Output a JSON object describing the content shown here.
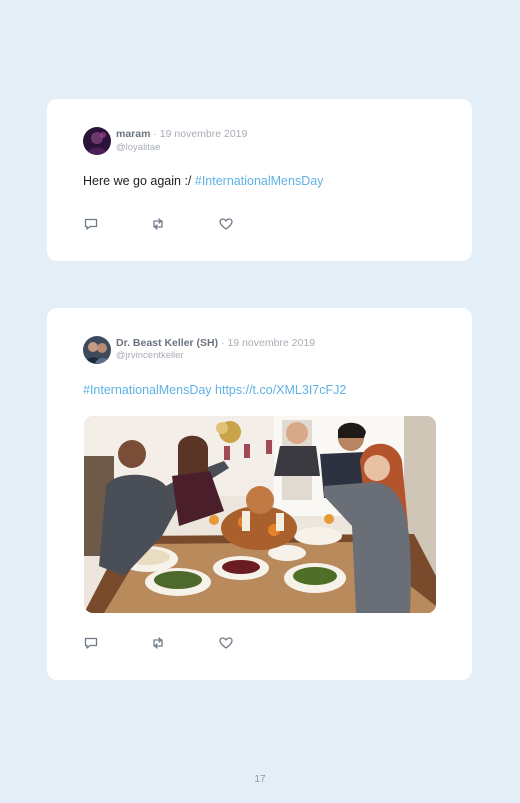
{
  "tweets": [
    {
      "name": "maram",
      "date": "19 novembre 2019",
      "handle": "@loyalitae",
      "text": "Here we go again :/ ",
      "hashtag": "#InternationalMensDay"
    },
    {
      "name": "Dr. Beast Keller (SH)",
      "date": "19 novembre 2019",
      "handle": "@jrvincentkeller",
      "hashtag": "#InternationalMensDay",
      "link": "https://t.co/XML3I7cFJ2"
    }
  ],
  "separator": " · ",
  "icons": [
    "reply-icon",
    "retweet-icon",
    "like-icon"
  ],
  "colors": {
    "background": "#e3eef6",
    "link": "#5fb2e6",
    "card": "#ffffff"
  },
  "page_number": "17"
}
